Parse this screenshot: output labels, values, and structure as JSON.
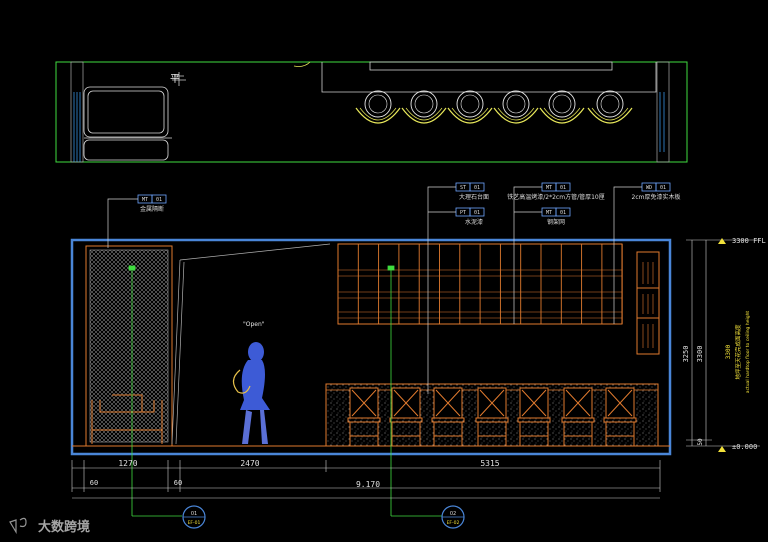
{
  "plan": {
    "label": "平"
  },
  "tags": [
    {
      "code": "MT",
      "num": "01",
      "desc": "金属隔断"
    },
    {
      "code": "ST",
      "num": "01",
      "desc": "大理石台面"
    },
    {
      "code": "PT",
      "num": "01",
      "desc": "水泥漆"
    },
    {
      "code": "MT",
      "num": "01",
      "desc": "铁艺高温烤漆/2*2cm方管/管厚10厘"
    },
    {
      "code": "MT",
      "num": "01",
      "desc": "钢架网"
    },
    {
      "code": "WD",
      "num": "01",
      "desc": "2cm厚免漆实木板"
    }
  ],
  "figure_label": "\"Open\"",
  "elevation": {
    "ffl_label": "3300 FFL",
    "zero_label": "±0.000",
    "vertical_dims": [
      "3250",
      "3300",
      "50"
    ],
    "vertical_note_big": "3300",
    "vertical_note_cn": "地坪至天花完成面高度",
    "vertical_note_en": "actual hardtop floor to ceiling height"
  },
  "dimensions": {
    "row1": [
      "1270",
      "2470",
      "5315"
    ],
    "row2": [
      "60",
      "60"
    ],
    "total": "9.170"
  },
  "callouts": [
    {
      "num": "01",
      "ref": "EF-01"
    },
    {
      "num": "02",
      "ref": "EF-02"
    }
  ],
  "watermark": "大数跨境",
  "colors": {
    "frame": "#4a86d8",
    "plan": "#3fdc3f",
    "furniture": "#e07a2e",
    "seat": "#e8e85a",
    "dim": "#dcdcdc",
    "tag": "#6fa6ff",
    "note_yellow": "#f2e13a",
    "figure": "#3d5bd6"
  }
}
